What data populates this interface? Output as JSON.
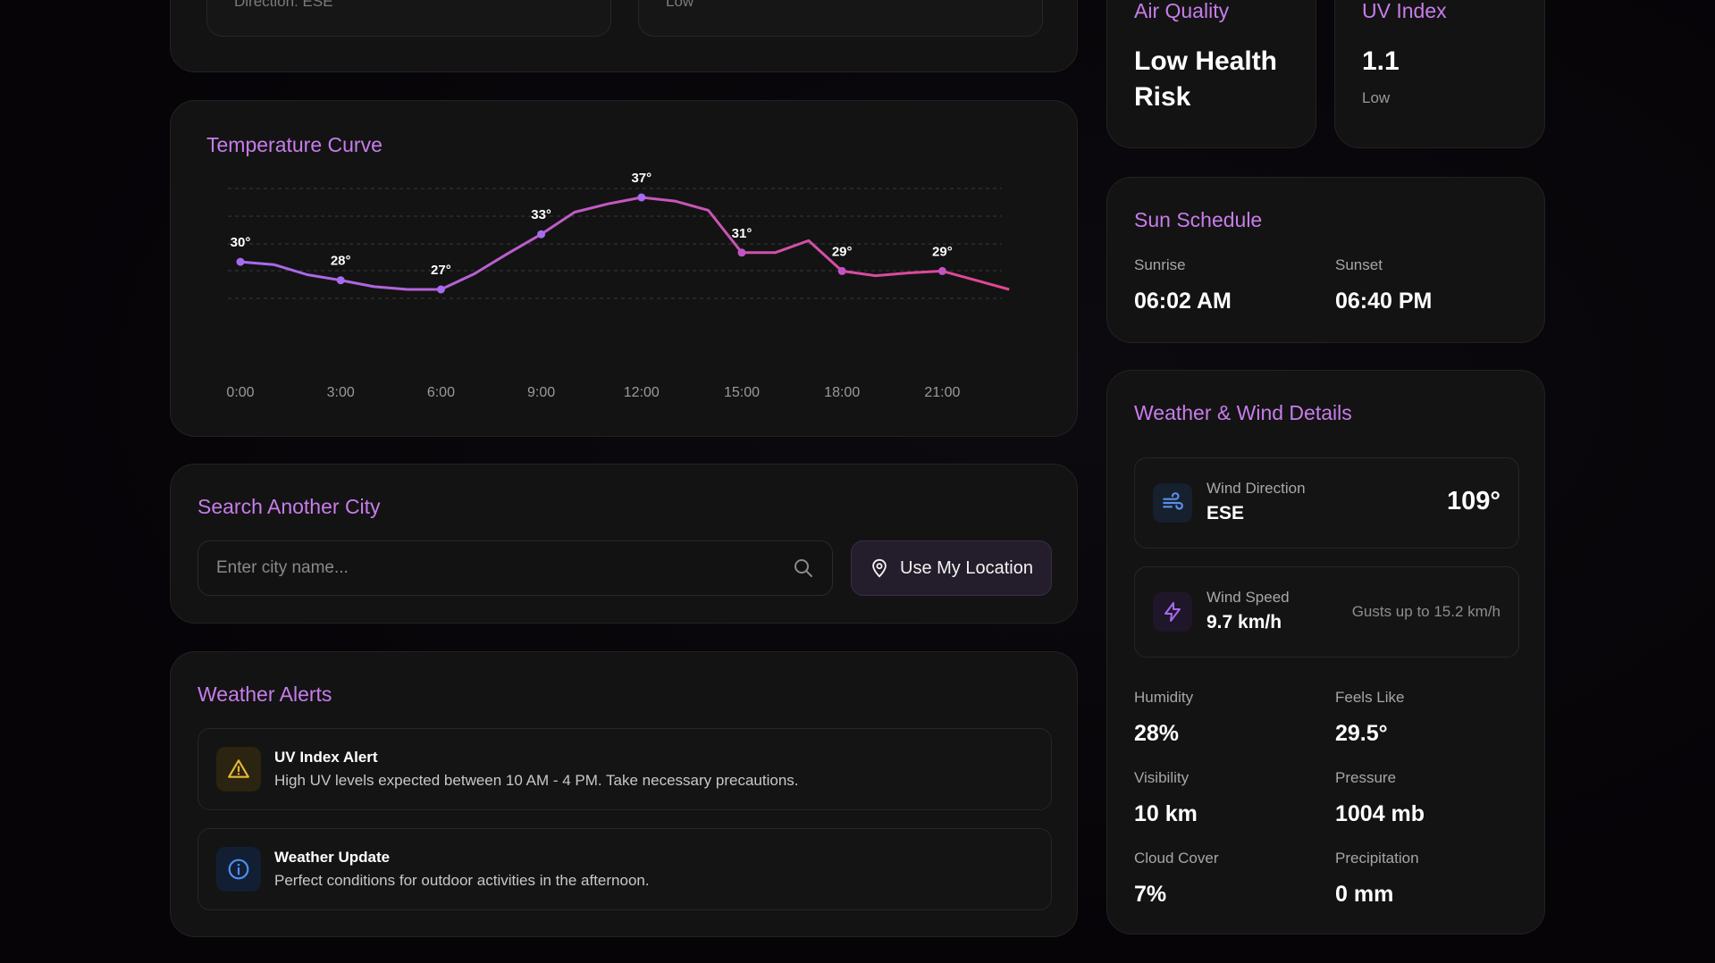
{
  "top_partial": {
    "left_mini_text": "Direction: ESE",
    "right_mini_text": "Low"
  },
  "air_quality": {
    "title": "Air Quality",
    "value": "Low Health Risk"
  },
  "uv_index": {
    "title": "UV Index",
    "value": "1.1",
    "level": "Low"
  },
  "temperature": {
    "title": "Temperature Curve"
  },
  "chart_data": {
    "type": "line",
    "title": "Temperature Curve",
    "x_ticks": [
      "0:00",
      "3:00",
      "6:00",
      "9:00",
      "12:00",
      "15:00",
      "18:00",
      "21:00"
    ],
    "hours": [
      0,
      1,
      2,
      3,
      4,
      5,
      6,
      7,
      8,
      9,
      10,
      11,
      12,
      13,
      14,
      15,
      16,
      17,
      18,
      19,
      20,
      21,
      22,
      23
    ],
    "values": [
      30,
      29.7,
      28.6,
      28,
      27.3,
      27,
      27,
      28.7,
      30.9,
      33,
      35.4,
      36.3,
      37,
      36.6,
      35.6,
      31,
      31,
      32.3,
      29,
      28.5,
      28.8,
      29,
      28,
      27
    ],
    "labeled_points": [
      {
        "hour": 0,
        "label": "30°"
      },
      {
        "hour": 3,
        "label": "28°"
      },
      {
        "hour": 6,
        "label": "27°"
      },
      {
        "hour": 9,
        "label": "33°"
      },
      {
        "hour": 12,
        "label": "37°"
      },
      {
        "hour": 15,
        "label": "31°"
      },
      {
        "hour": 18,
        "label": "29°"
      },
      {
        "hour": 21,
        "label": "29°"
      }
    ],
    "grid": true,
    "colors": {
      "start": "#a56cf0",
      "end": "#e2458f"
    }
  },
  "search": {
    "title": "Search Another City",
    "placeholder": "Enter city name...",
    "location_button": "Use My Location"
  },
  "alerts": {
    "title": "Weather Alerts",
    "items": [
      {
        "title": "UV Index Alert",
        "desc": "High UV levels expected between 10 AM - 4 PM. Take necessary precautions.",
        "icon": "warning-icon",
        "color": "#e8b53a"
      },
      {
        "title": "Weather Update",
        "desc": "Perfect conditions for outdoor activities in the afternoon.",
        "icon": "info-icon",
        "color": "#4f8ef5"
      }
    ]
  },
  "sun": {
    "title": "Sun Schedule",
    "sunrise_label": "Sunrise",
    "sunrise": "06:02 AM",
    "sunset_label": "Sunset",
    "sunset": "06:40 PM"
  },
  "wind": {
    "title": "Weather & Wind Details",
    "direction_label": "Wind Direction",
    "direction": "ESE",
    "degrees": "109°",
    "speed_label": "Wind Speed",
    "speed": "9.7 km/h",
    "gusts": "Gusts up to 15.2 km/h"
  },
  "details": [
    {
      "label": "Humidity",
      "value": "28%"
    },
    {
      "label": "Feels Like",
      "value": "29.5°"
    },
    {
      "label": "Visibility",
      "value": "10 km"
    },
    {
      "label": "Pressure",
      "value": "1004 mb"
    },
    {
      "label": "Cloud Cover",
      "value": "7%"
    },
    {
      "label": "Precipitation",
      "value": "0 mm"
    }
  ]
}
